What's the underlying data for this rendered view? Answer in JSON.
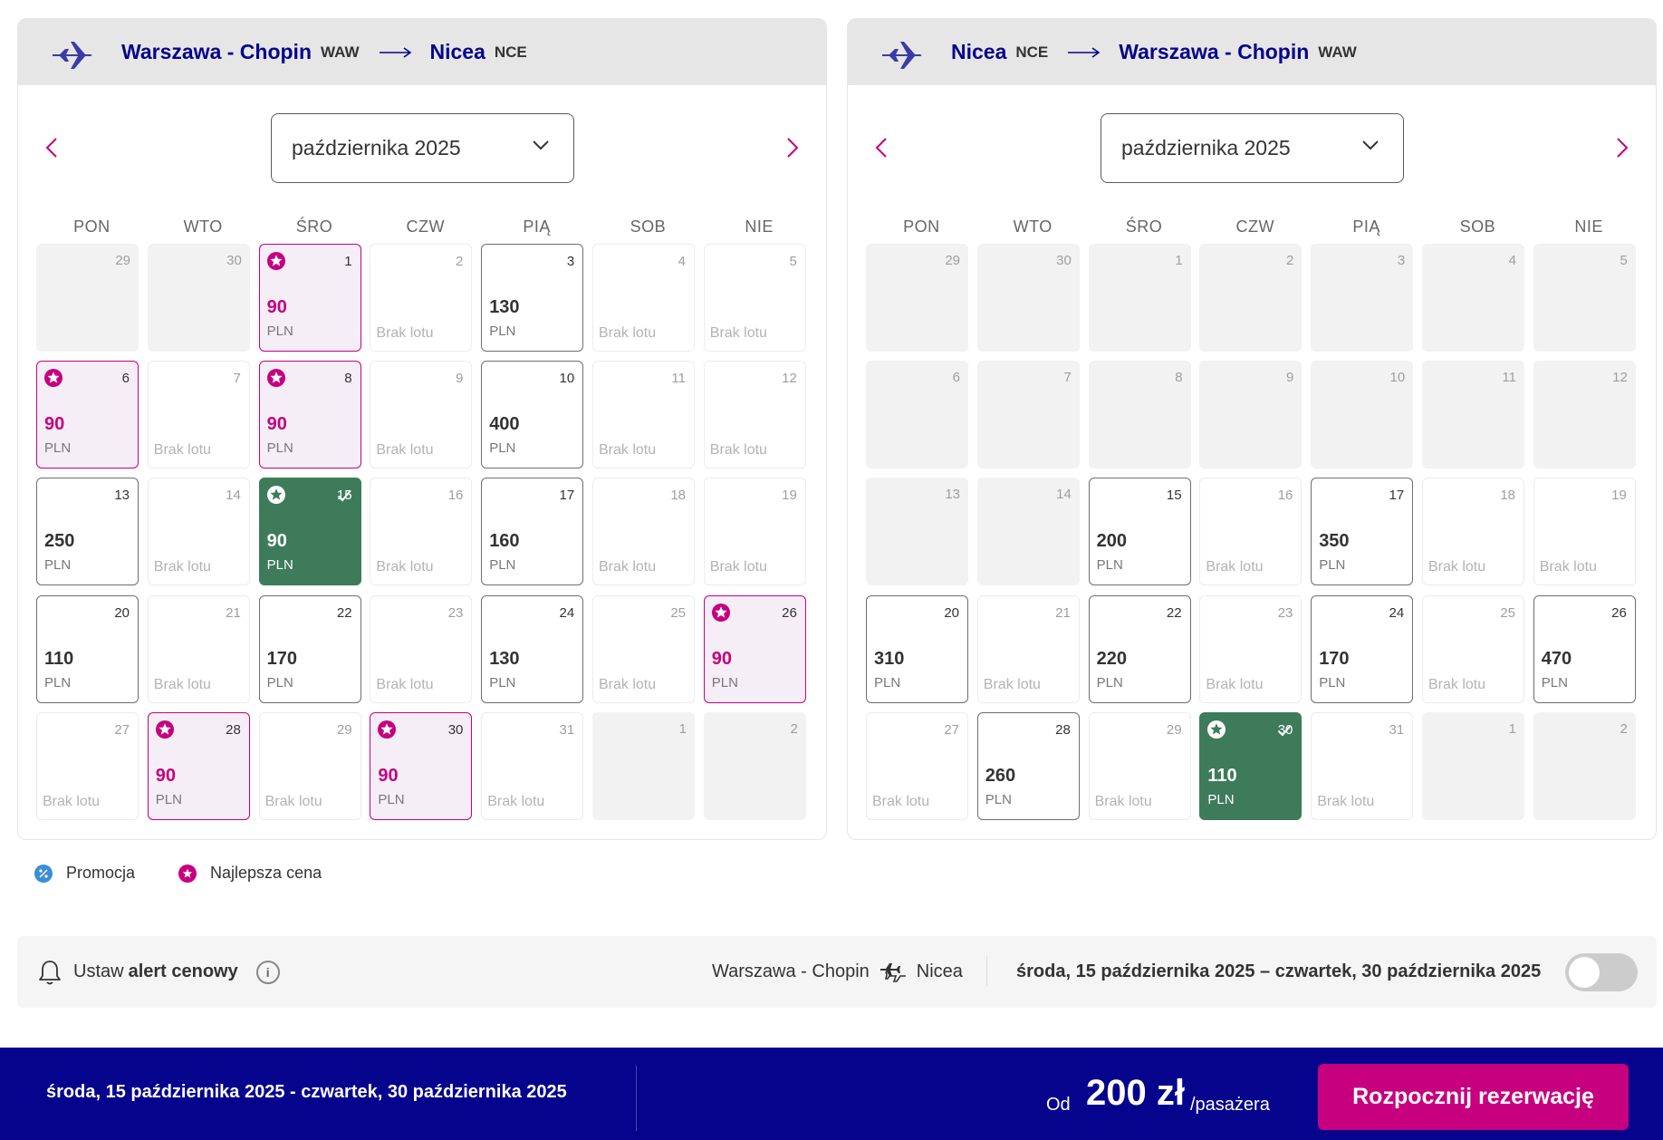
{
  "outbound": {
    "from_city": "Warszawa - Chopin",
    "from_code": "WAW",
    "to_city": "Nicea",
    "to_code": "NCE",
    "month": "października 2025",
    "days": [
      {
        "d": "29",
        "s": "disabled"
      },
      {
        "d": "30",
        "s": "disabled"
      },
      {
        "d": "1",
        "s": "best",
        "p": "90"
      },
      {
        "d": "2",
        "s": "none"
      },
      {
        "d": "3",
        "s": "price",
        "p": "130"
      },
      {
        "d": "4",
        "s": "none"
      },
      {
        "d": "5",
        "s": "none"
      },
      {
        "d": "6",
        "s": "best",
        "p": "90"
      },
      {
        "d": "7",
        "s": "none"
      },
      {
        "d": "8",
        "s": "best",
        "p": "90"
      },
      {
        "d": "9",
        "s": "none"
      },
      {
        "d": "10",
        "s": "price",
        "p": "400"
      },
      {
        "d": "11",
        "s": "none"
      },
      {
        "d": "12",
        "s": "none"
      },
      {
        "d": "13",
        "s": "price",
        "p": "250"
      },
      {
        "d": "14",
        "s": "none"
      },
      {
        "d": "15",
        "s": "selected",
        "p": "90"
      },
      {
        "d": "16",
        "s": "none"
      },
      {
        "d": "17",
        "s": "price",
        "p": "160"
      },
      {
        "d": "18",
        "s": "none"
      },
      {
        "d": "19",
        "s": "none"
      },
      {
        "d": "20",
        "s": "price",
        "p": "110"
      },
      {
        "d": "21",
        "s": "none"
      },
      {
        "d": "22",
        "s": "price",
        "p": "170"
      },
      {
        "d": "23",
        "s": "none"
      },
      {
        "d": "24",
        "s": "price",
        "p": "130"
      },
      {
        "d": "25",
        "s": "none"
      },
      {
        "d": "26",
        "s": "best",
        "p": "90"
      },
      {
        "d": "27",
        "s": "none"
      },
      {
        "d": "28",
        "s": "best",
        "p": "90"
      },
      {
        "d": "29",
        "s": "none"
      },
      {
        "d": "30",
        "s": "best",
        "p": "90"
      },
      {
        "d": "31",
        "s": "none"
      },
      {
        "d": "1",
        "s": "disabled",
        "blank": true
      },
      {
        "d": "2",
        "s": "disabled",
        "blank": true
      }
    ]
  },
  "return": {
    "from_city": "Nicea",
    "from_code": "NCE",
    "to_city": "Warszawa - Chopin",
    "to_code": "WAW",
    "month": "października 2025",
    "days": [
      {
        "d": "29",
        "s": "disabled"
      },
      {
        "d": "30",
        "s": "disabled"
      },
      {
        "d": "1",
        "s": "disabled"
      },
      {
        "d": "2",
        "s": "disabled"
      },
      {
        "d": "3",
        "s": "disabled"
      },
      {
        "d": "4",
        "s": "disabled"
      },
      {
        "d": "5",
        "s": "disabled"
      },
      {
        "d": "6",
        "s": "disabled"
      },
      {
        "d": "7",
        "s": "disabled"
      },
      {
        "d": "8",
        "s": "disabled"
      },
      {
        "d": "9",
        "s": "disabled"
      },
      {
        "d": "10",
        "s": "disabled"
      },
      {
        "d": "11",
        "s": "disabled"
      },
      {
        "d": "12",
        "s": "disabled"
      },
      {
        "d": "13",
        "s": "disabled"
      },
      {
        "d": "14",
        "s": "disabled"
      },
      {
        "d": "15",
        "s": "price",
        "p": "200"
      },
      {
        "d": "16",
        "s": "none"
      },
      {
        "d": "17",
        "s": "price",
        "p": "350"
      },
      {
        "d": "18",
        "s": "none"
      },
      {
        "d": "19",
        "s": "none"
      },
      {
        "d": "20",
        "s": "price",
        "p": "310"
      },
      {
        "d": "21",
        "s": "none"
      },
      {
        "d": "22",
        "s": "price",
        "p": "220"
      },
      {
        "d": "23",
        "s": "none"
      },
      {
        "d": "24",
        "s": "price",
        "p": "170"
      },
      {
        "d": "25",
        "s": "none"
      },
      {
        "d": "26",
        "s": "price",
        "p": "470"
      },
      {
        "d": "27",
        "s": "none"
      },
      {
        "d": "28",
        "s": "price",
        "p": "260"
      },
      {
        "d": "29",
        "s": "none"
      },
      {
        "d": "30",
        "s": "selected",
        "p": "110"
      },
      {
        "d": "31",
        "s": "none"
      },
      {
        "d": "1",
        "s": "disabled"
      },
      {
        "d": "2",
        "s": "disabled"
      }
    ]
  },
  "weekdays": [
    "PON",
    "WTO",
    "ŚRO",
    "CZW",
    "PIĄ",
    "SOB",
    "NIE"
  ],
  "labels": {
    "no_flight": "Brak lotu",
    "currency": "PLN"
  },
  "legend": {
    "promo": "Promocja",
    "best": "Najlepsza cena"
  },
  "alert": {
    "prefix": "Ustaw",
    "bold": "alert cenowy",
    "route_from": "Warszawa - Chopin",
    "route_to": "Nicea",
    "range": "środa, 15 października 2025 – czwartek, 30 października 2025",
    "enabled": false
  },
  "footer": {
    "dates": "środa, 15 października 2025 - czwartek, 30 października 2025",
    "from_label": "Od",
    "price": "200 zł",
    "per": "/pasażera",
    "cta": "Rozpocznij rezerwację"
  },
  "colors": {
    "brand_navy": "#06038d",
    "brand_magenta": "#c6007e",
    "selected_green": "#3e7b5a",
    "promo_blue": "#3a8fd6"
  }
}
